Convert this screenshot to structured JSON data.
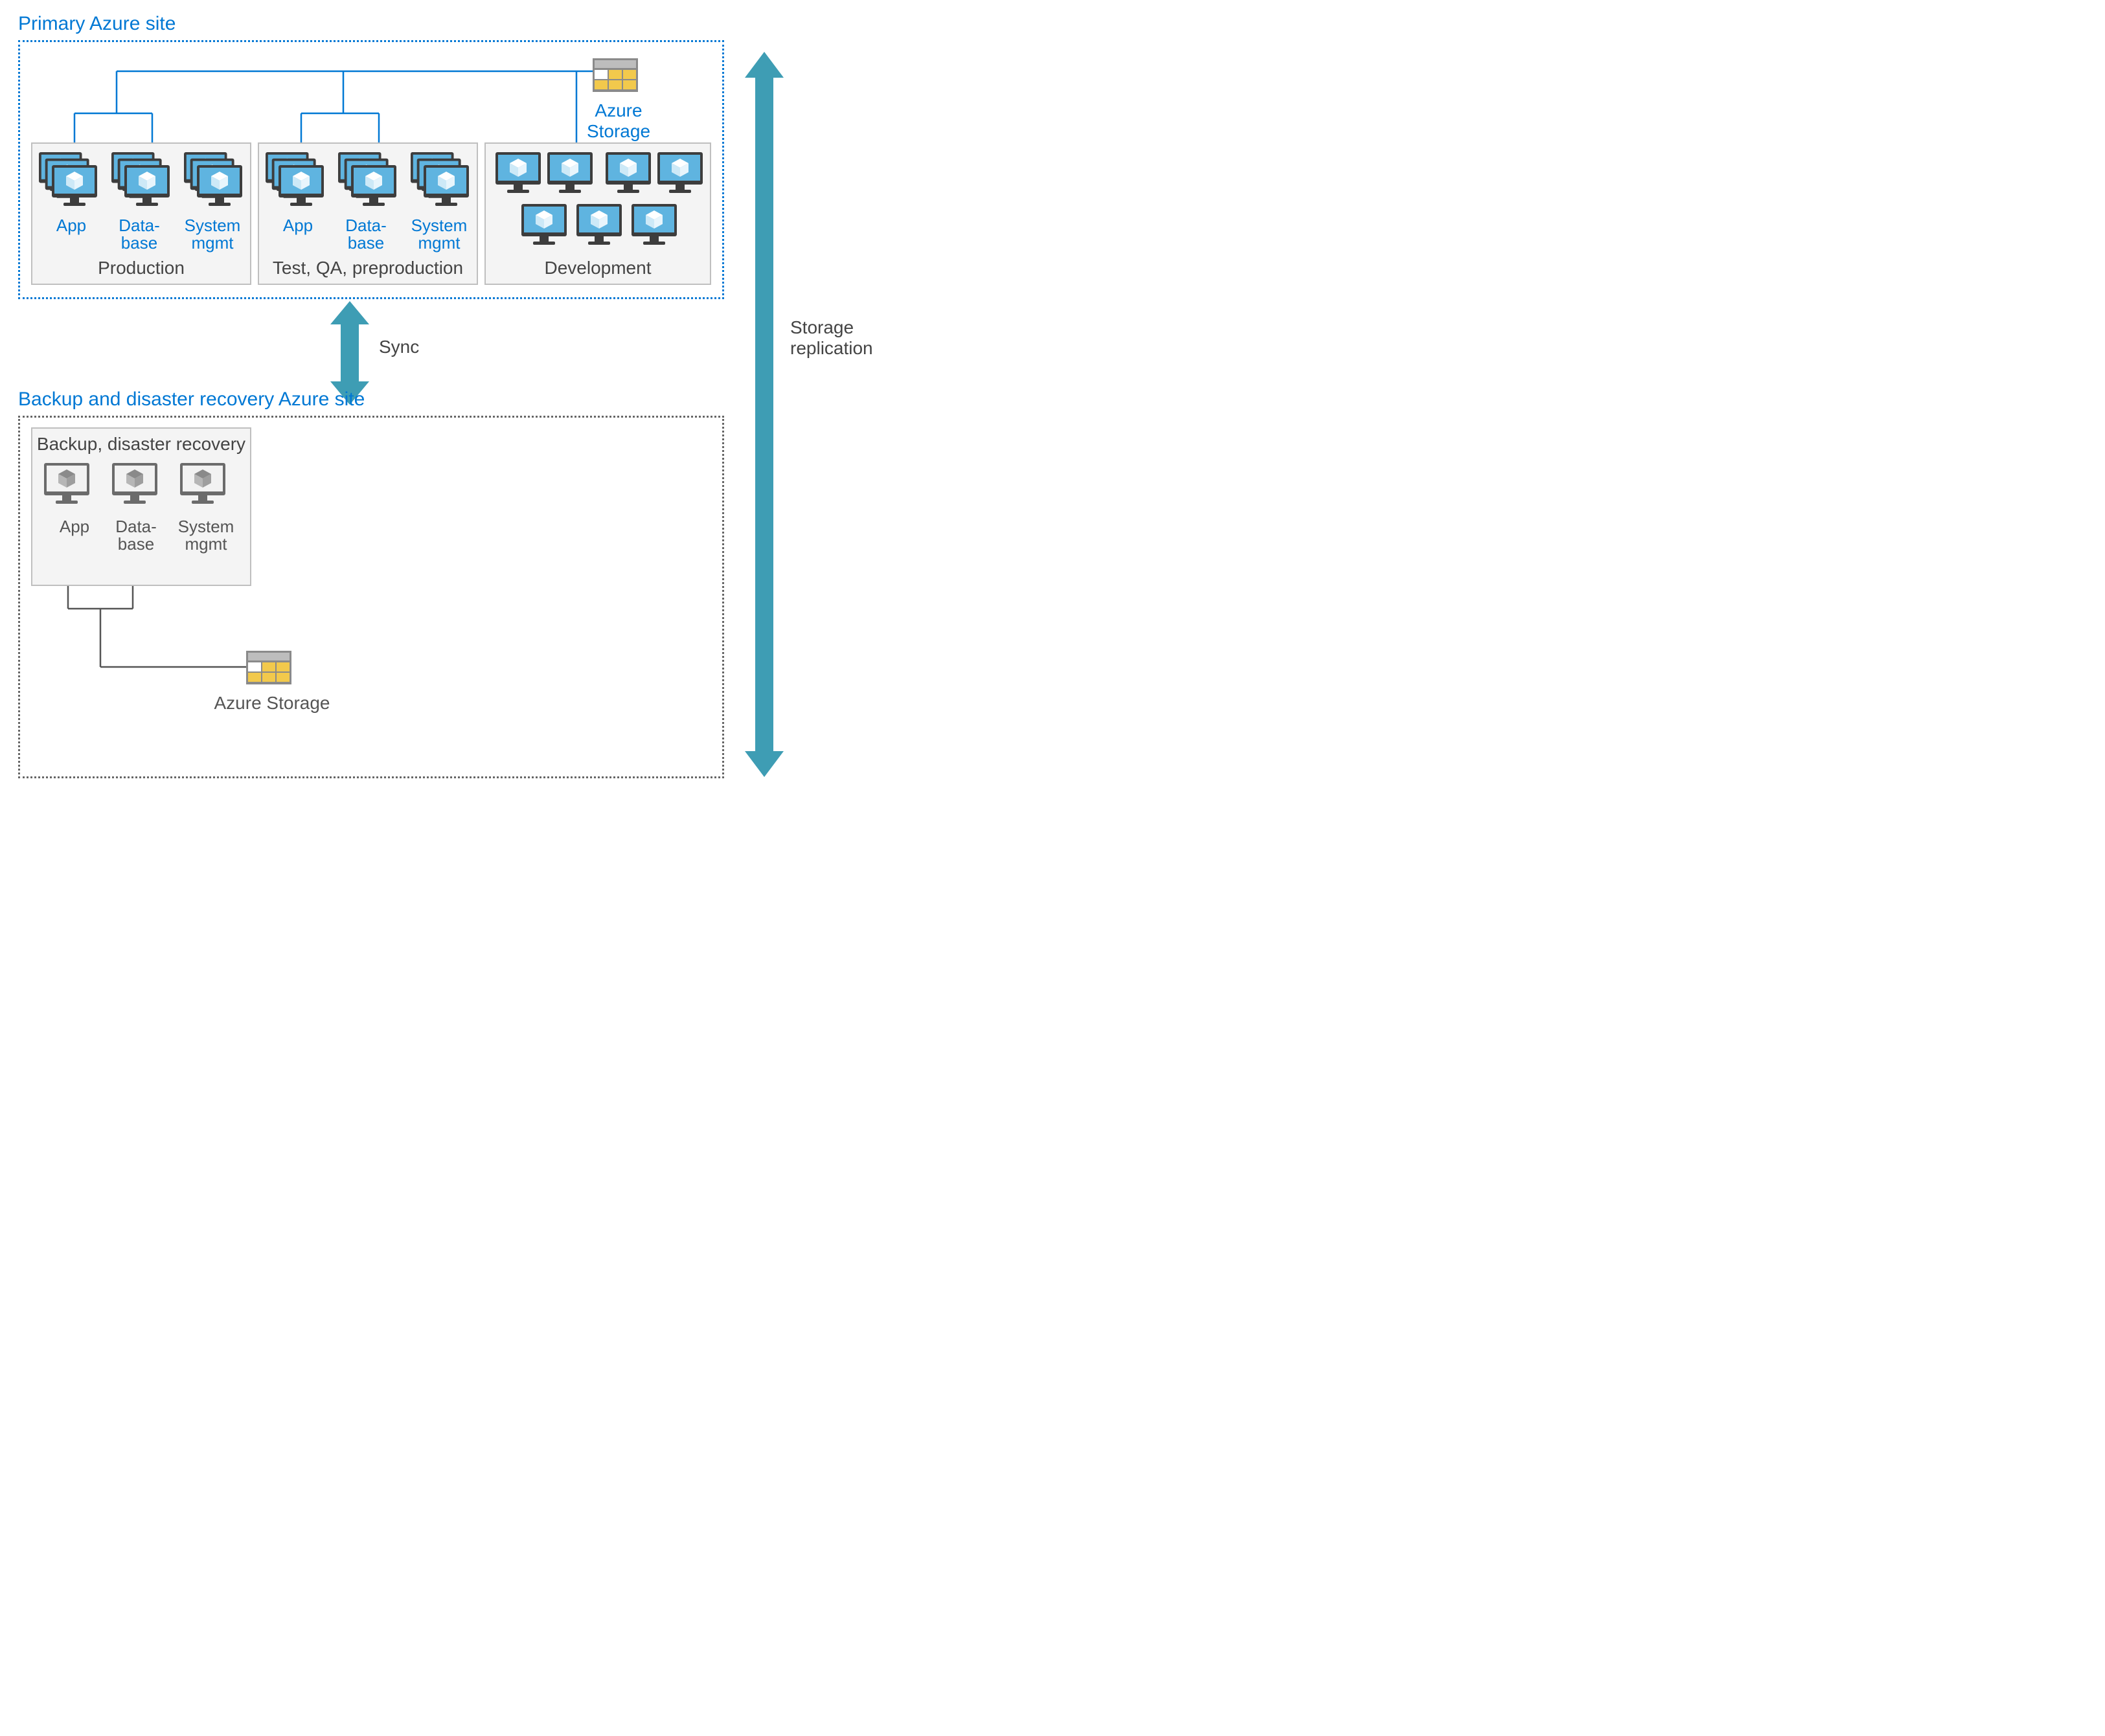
{
  "colors": {
    "azure_blue": "#0078d4",
    "teal_arrow": "#3E9DB4",
    "gray": "#666666",
    "vm_blue_light": "#9ED3EB",
    "vm_blue_dark": "#4FA8D8",
    "storage_yellow": "#F2C94C",
    "monitor_dark": "#3d3d3d"
  },
  "primary": {
    "title": "Primary Azure site",
    "storage_label": "Azure Storage",
    "envs": {
      "production": {
        "title": "Production",
        "groups": [
          "App",
          "Data-\nbase",
          "System\nmgmt"
        ]
      },
      "testqa": {
        "title": "Test, QA, preproduction",
        "groups": [
          "App",
          "Data-\nbase",
          "System\nmgmt"
        ]
      },
      "development": {
        "title": "Development"
      }
    }
  },
  "sync_label": "Sync",
  "backup": {
    "title": "Backup and disaster recovery Azure site",
    "env_title": "Backup, disaster recovery",
    "groups": [
      "App",
      "Data-\nbase",
      "System\nmgmt"
    ],
    "storage_label": "Azure Storage"
  },
  "replication_label": "Storage\nreplication"
}
